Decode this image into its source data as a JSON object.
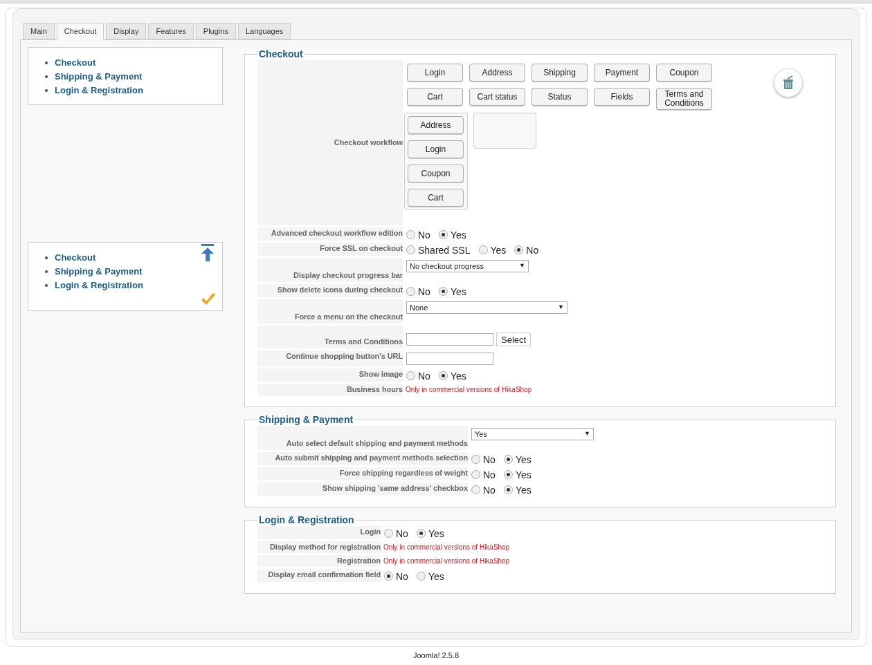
{
  "tabs": [
    {
      "label": "Main",
      "selected": false
    },
    {
      "label": "Checkout",
      "selected": true
    },
    {
      "label": "Display",
      "selected": false
    },
    {
      "label": "Features",
      "selected": false
    },
    {
      "label": "Plugins",
      "selected": false
    },
    {
      "label": "Languages",
      "selected": false
    }
  ],
  "side_menus": [
    {
      "kind": "plain",
      "items": [
        "Checkout",
        "Shipping & Payment",
        "Login & Registration"
      ]
    },
    {
      "kind": "floating",
      "items": [
        "Checkout",
        "Shipping & Payment",
        "Login & Registration"
      ]
    }
  ],
  "sections": [
    {
      "title": "Checkout",
      "rows": [
        {
          "kind": "workflow",
          "label": "Checkout workflow",
          "available": [
            "Login",
            "Address",
            "Shipping",
            "Payment",
            "Coupon",
            "Cart",
            "Cart status",
            "Status",
            "Fields",
            "Terms and Conditions"
          ],
          "steps": [
            "Address",
            "Login",
            "Coupon",
            "Cart"
          ]
        },
        {
          "kind": "radio",
          "label": "Advanced checkout workflow edition",
          "options": [
            {
              "label": "No",
              "selected": false
            },
            {
              "label": "Yes",
              "selected": true
            }
          ]
        },
        {
          "kind": "radio",
          "label": "Force SSL on checkout",
          "options": [
            {
              "label": "Shared SSL",
              "selected": false
            },
            {
              "label": "Yes",
              "selected": false
            },
            {
              "label": "No",
              "selected": true
            }
          ]
        },
        {
          "kind": "select",
          "label": "Display checkout progress bar",
          "value": "No checkout progress",
          "arrow": "▼"
        },
        {
          "kind": "radio",
          "label": "Show delete icons during checkout",
          "options": [
            {
              "label": "No",
              "selected": false
            },
            {
              "label": "Yes",
              "selected": true
            }
          ]
        },
        {
          "kind": "wide_select",
          "label": "Force a menu on the checkout",
          "value": "None",
          "arrow": "▼"
        },
        {
          "kind": "text_select",
          "label": "Terms and Conditions",
          "button": "Select"
        },
        {
          "kind": "text",
          "label": "Continue shopping button's URL"
        },
        {
          "kind": "radio",
          "label": "Show image",
          "options": [
            {
              "label": "No",
              "selected": false
            },
            {
              "label": "Yes",
              "selected": true
            }
          ]
        },
        {
          "kind": "note",
          "label": "Business hours",
          "text": "Only in commercial versions of HikaShop"
        }
      ]
    },
    {
      "title": "Shipping & Payment",
      "rows": [
        {
          "kind": "select",
          "label": "Auto select default shipping and payment methods",
          "value": "Yes",
          "arrow": "▼"
        },
        {
          "kind": "radio",
          "label": "Auto submit shipping and payment methods selection",
          "options": [
            {
              "label": "No",
              "selected": false
            },
            {
              "label": "Yes",
              "selected": true
            }
          ]
        },
        {
          "kind": "radio",
          "label": "Force shipping regardless of weight",
          "options": [
            {
              "label": "No",
              "selected": false
            },
            {
              "label": "Yes",
              "selected": true
            }
          ]
        },
        {
          "kind": "radio",
          "label": "Show shipping 'same address' checkbox",
          "options": [
            {
              "label": "No",
              "selected": false
            },
            {
              "label": "Yes",
              "selected": true
            }
          ]
        }
      ]
    },
    {
      "title": "Login & Registration",
      "rows": [
        {
          "kind": "radio",
          "label": "Login",
          "options": [
            {
              "label": "No",
              "selected": false
            },
            {
              "label": "Yes",
              "selected": true
            }
          ]
        },
        {
          "kind": "note",
          "label": "Display method for registration",
          "text": "Only in commercial versions of HikaShop"
        },
        {
          "kind": "note",
          "label": "Registration",
          "text": "Only in commercial versions of HikaShop"
        },
        {
          "kind": "radio",
          "label": "Display email confirmation field",
          "options": [
            {
              "label": "No",
              "selected": true
            },
            {
              "label": "Yes",
              "selected": false
            }
          ]
        }
      ]
    }
  ],
  "footer": "Joomla! 2.5.8"
}
